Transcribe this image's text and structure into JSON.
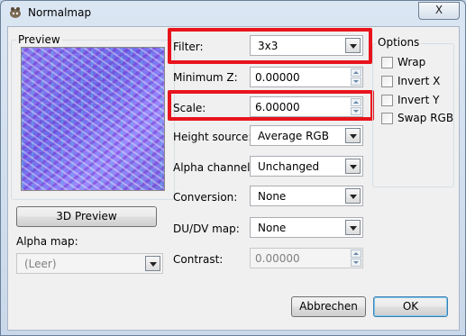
{
  "window": {
    "title": "Normalmap",
    "close_label": "X"
  },
  "preview": {
    "label": "Preview",
    "button_label": "3D Preview"
  },
  "alpha_map": {
    "label": "Alpha map:",
    "value": "(Leer)"
  },
  "settings": {
    "filter": {
      "label": "Filter:",
      "value": "3x3"
    },
    "minimum_z": {
      "label": "Minimum Z:",
      "value": "0.00000"
    },
    "scale": {
      "label": "Scale:",
      "value": "6.00000"
    },
    "height_source": {
      "label": "Height source:",
      "value": "Average RGB"
    },
    "alpha_channel": {
      "label": "Alpha channel:",
      "value": "Unchanged"
    },
    "conversion": {
      "label": "Conversion:",
      "value": "None"
    },
    "dudv_map": {
      "label": "DU/DV map:",
      "value": "None"
    },
    "contrast": {
      "label": "Contrast:",
      "value": "0.00000"
    }
  },
  "options": {
    "label": "Options",
    "items": [
      {
        "label": "Wrap",
        "checked": false
      },
      {
        "label": "Invert X",
        "checked": false
      },
      {
        "label": "Invert Y",
        "checked": false
      },
      {
        "label": "Swap RGB",
        "checked": false
      }
    ]
  },
  "buttons": {
    "cancel": "Abbrechen",
    "ok": "OK"
  },
  "colors": {
    "highlight": "#e8141c",
    "default_button_border": "#3c7fb1"
  }
}
